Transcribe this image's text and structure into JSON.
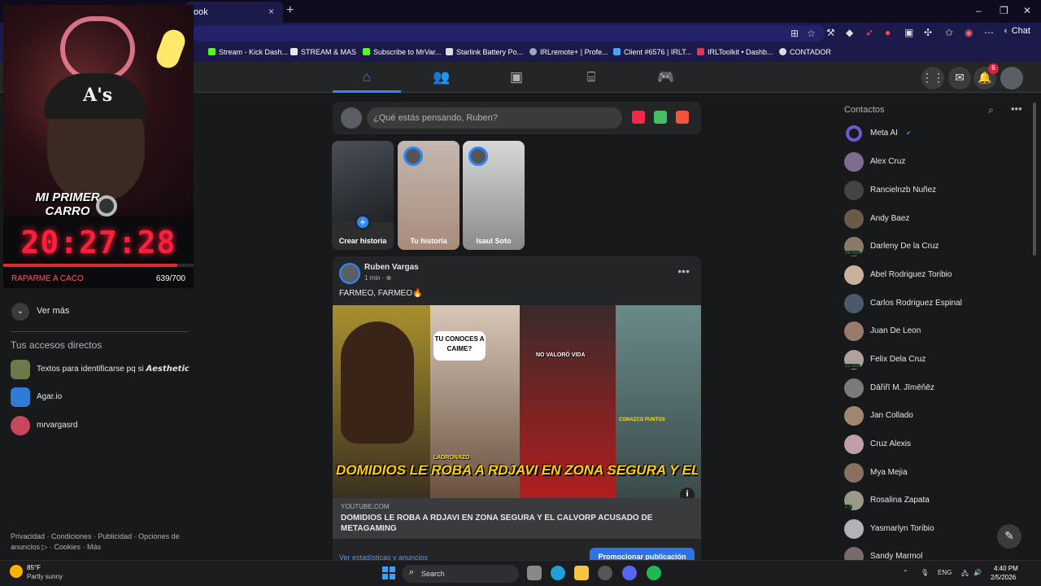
{
  "browser": {
    "active_tab_title": "ook",
    "tab_close": "×",
    "new_tab": "+",
    "window_controls": [
      "–",
      "❐",
      "✕"
    ],
    "chat_label": "Chat",
    "bookmarks": [
      {
        "label": "Stream - Kick Dash...",
        "icon": "kick-icon",
        "color": "#53fc18"
      },
      {
        "label": "STREAM & MAS",
        "icon": "folder-icon",
        "color": "#f5f5f5"
      },
      {
        "label": "Subscribe to MrVar...",
        "icon": "kick-icon",
        "color": "#53fc18"
      },
      {
        "label": "Starlink Battery Po...",
        "icon": "page-icon",
        "color": "#dddddd"
      },
      {
        "label": "IRLremote+ | Profe...",
        "icon": "globe-icon",
        "color": "#9ab"
      },
      {
        "label": "Client #6576 | IRLT...",
        "icon": "cloud-icon",
        "color": "#4aa3ff"
      },
      {
        "label": "IRLToolkit • Dashb...",
        "icon": "irltoolkit-icon",
        "color": "#e8334a"
      },
      {
        "label": "CONTADOR",
        "icon": "counter-icon",
        "color": "#dddddd"
      }
    ]
  },
  "facebook": {
    "nav_tabs": [
      {
        "name": "home",
        "icon": "home-icon",
        "glyph": "⌂",
        "active": true
      },
      {
        "name": "friends",
        "icon": "friends-icon",
        "glyph": "👥",
        "active": false
      },
      {
        "name": "video",
        "icon": "video-icon",
        "glyph": "▣",
        "active": false
      },
      {
        "name": "marketplace",
        "icon": "marketplace-icon",
        "glyph": "⌸",
        "active": false
      },
      {
        "name": "gaming",
        "icon": "gaming-icon",
        "glyph": "🎮",
        "active": false
      }
    ],
    "notification_count": "6",
    "stream_overlay": {
      "title_line1": "MI PRIMER",
      "title_line2": "CARRO",
      "hat_logo": "A's",
      "timer": "20:27:28",
      "goal_label": "RAPARME A CACO",
      "goal_count": "639/700",
      "goal_progress": 0.913
    },
    "left_sidebar": {
      "see_more": "Ver más",
      "shortcuts_title": "Tus accesos directos",
      "shortcuts": [
        {
          "label": "Textos para identificarse pq si 𝘼𝙚𝙨𝙩𝙝𝙚𝙩𝙞𝙘",
          "color": "#6b7a4a"
        },
        {
          "label": "Agar.io",
          "color": "#2f7bd8"
        },
        {
          "label": "mrvargasrd",
          "color": "#c7475e"
        }
      ],
      "footer": "Privacidad · Condiciones · Publicidad · Opciones de anuncios ▷ · Cookies · Más"
    },
    "composer": {
      "placeholder": "¿Qué estás pensando, Ruben?"
    },
    "stories": [
      {
        "label": "Crear historia",
        "type": "create"
      },
      {
        "label": "Tu historia",
        "type": "story"
      },
      {
        "label": "Isaul Soto",
        "type": "story"
      }
    ],
    "post": {
      "author": "Ruben Vargas",
      "time": "1 min · ⊕",
      "text": "FARMEO, FARMEO🔥",
      "thumbnail": {
        "bubble": "TU CONOCES A CAIME?",
        "tag_center": "NO VALORÓ VIDA",
        "tag_left": "LADRONAZO",
        "tag_right": "CONAZCO PUNTOS",
        "headline": "DOMIDIOS LE ROBA A RDJAVI EN ZONA SEGURA Y EL CALVORP ACUSADO DE METAGAMING"
      },
      "link_domain": "YOUTUBE.COM",
      "link_title": "DOMIDIOS LE ROBA A RDJAVI EN ZONA SEGURA Y EL CALVORP ACUSADO DE METAGAMING",
      "stats_link": "Ver estadísticas y anuncios",
      "promote_button": "Promocionar publicación",
      "menu": "•••"
    },
    "contacts": {
      "title": "Contactos",
      "list": [
        {
          "name": "Meta AI",
          "verified": true,
          "ago": "",
          "color": "#6a5acd"
        },
        {
          "name": "Alex Cruz",
          "ago": "",
          "color": "#7d6c8e"
        },
        {
          "name": "Rancielnzb Nuñez",
          "ago": "",
          "color": "#444"
        },
        {
          "name": "Andy Baez",
          "ago": "",
          "color": "#6b5a4a"
        },
        {
          "name": "Darleny De la Cruz",
          "ago": "29 min",
          "color": "#8a7a6a"
        },
        {
          "name": "Abel Rodriguez Toribio",
          "ago": "",
          "color": "#c9b29a"
        },
        {
          "name": "Carlos Rodriguez Espinal",
          "ago": "",
          "color": "#4a5a6a"
        },
        {
          "name": "Juan De Leon",
          "ago": "",
          "color": "#9a7a6a"
        },
        {
          "name": "Felix Dela Cruz",
          "ago": "22 min",
          "color": "#b0a0a0"
        },
        {
          "name": "Dāřiřī M. Jīmēňēz",
          "ago": "",
          "color": "#7a7a7a"
        },
        {
          "name": "Jan Collado",
          "ago": "",
          "color": "#a08870"
        },
        {
          "name": "Cruz Alexis",
          "ago": "",
          "color": "#c0a0a8"
        },
        {
          "name": "Mya Mejia",
          "ago": "",
          "color": "#8a7060"
        },
        {
          "name": "Rosalina Zapata",
          "ago": "1 h",
          "color": "#9a9a8a"
        },
        {
          "name": "Yasmarlyn Toribio",
          "ago": "",
          "color": "#b0b3b8"
        },
        {
          "name": "Sandy Marmol",
          "ago": "",
          "color": "#7a6a6a"
        }
      ]
    }
  },
  "taskbar": {
    "weather_temp": "85°F",
    "weather_desc": "Partly sunny",
    "search_label": "Search",
    "language": "ENG",
    "time": "4:40 PM",
    "date": "2/5/2026"
  }
}
